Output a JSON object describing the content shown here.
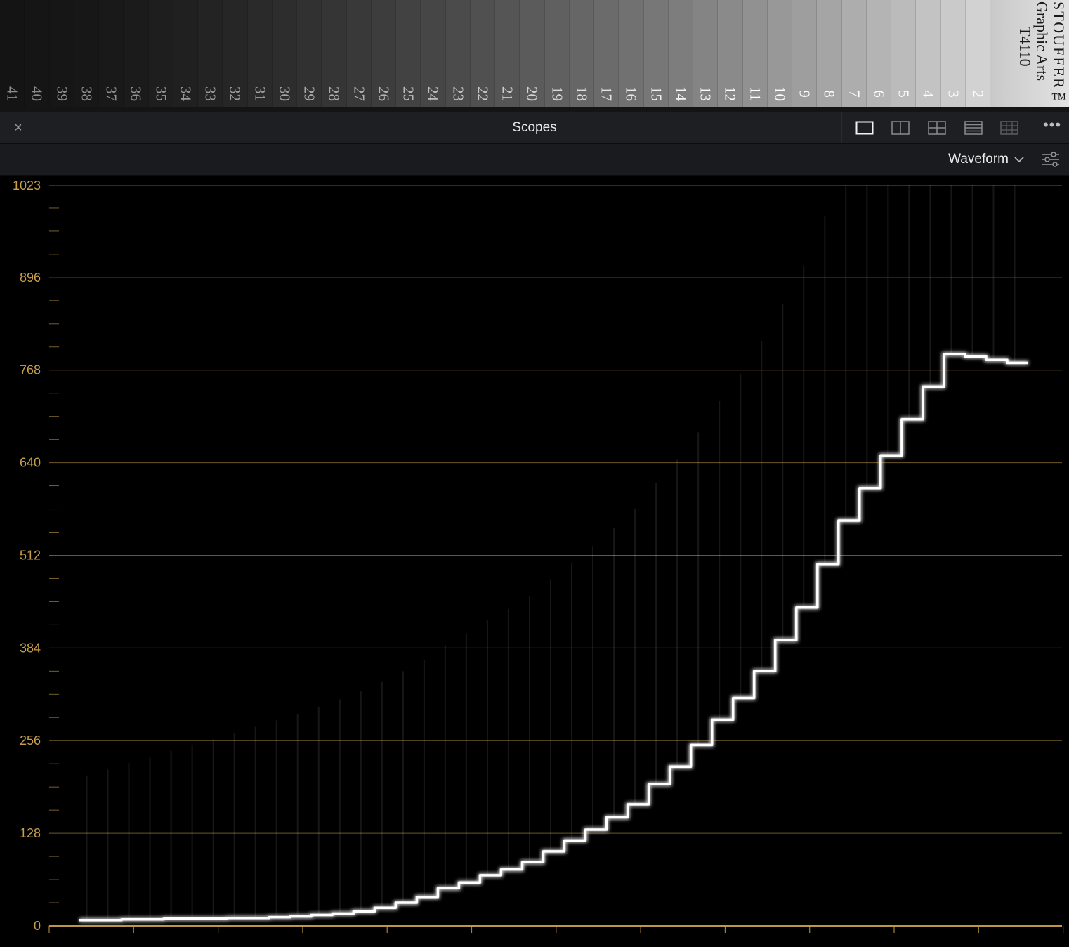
{
  "wedge": {
    "steps": [
      "41",
      "40",
      "39",
      "38",
      "37",
      "36",
      "35",
      "34",
      "33",
      "32",
      "31",
      "30",
      "29",
      "28",
      "27",
      "26",
      "25",
      "24",
      "23",
      "22",
      "21",
      "20",
      "19",
      "18",
      "17",
      "16",
      "15",
      "14",
      "13",
      "12",
      "11",
      "10",
      "9",
      "8",
      "7",
      "6",
      "5",
      "4",
      "3",
      "2"
    ],
    "brand": [
      "STOUFFER™",
      "Graphic Arts",
      "T4110"
    ]
  },
  "titlebar": {
    "close_icon": "×",
    "title": "Scopes",
    "more_icon": "•••",
    "layouts": [
      "single-view-icon",
      "two-up-view-icon",
      "four-up-view-icon",
      "stacked-view-icon",
      "grid-view-icon"
    ]
  },
  "modebar": {
    "mode": "Waveform",
    "settings_icon": "sliders-icon"
  },
  "scale": {
    "labels": [
      "1023",
      "896",
      "768",
      "640",
      "512",
      "384",
      "256",
      "128",
      "0"
    ],
    "values": [
      1023,
      896,
      768,
      640,
      512,
      384,
      256,
      128,
      0
    ]
  },
  "colors": {
    "graticule": "#c8a04a",
    "trace": "#ffffff"
  },
  "chart_data": {
    "type": "line",
    "ylim": [
      0,
      1023
    ],
    "series": [
      {
        "values": [
          8,
          8,
          9,
          9,
          10,
          10,
          10,
          11,
          11,
          12,
          13,
          15,
          17,
          20,
          25,
          32,
          40,
          52,
          60,
          70,
          78,
          88,
          103,
          118,
          133,
          150,
          168,
          196,
          220,
          250,
          285,
          315,
          352,
          395,
          440,
          500,
          560,
          605,
          650,
          700,
          745,
          790,
          787,
          782,
          778
        ]
      }
    ]
  }
}
